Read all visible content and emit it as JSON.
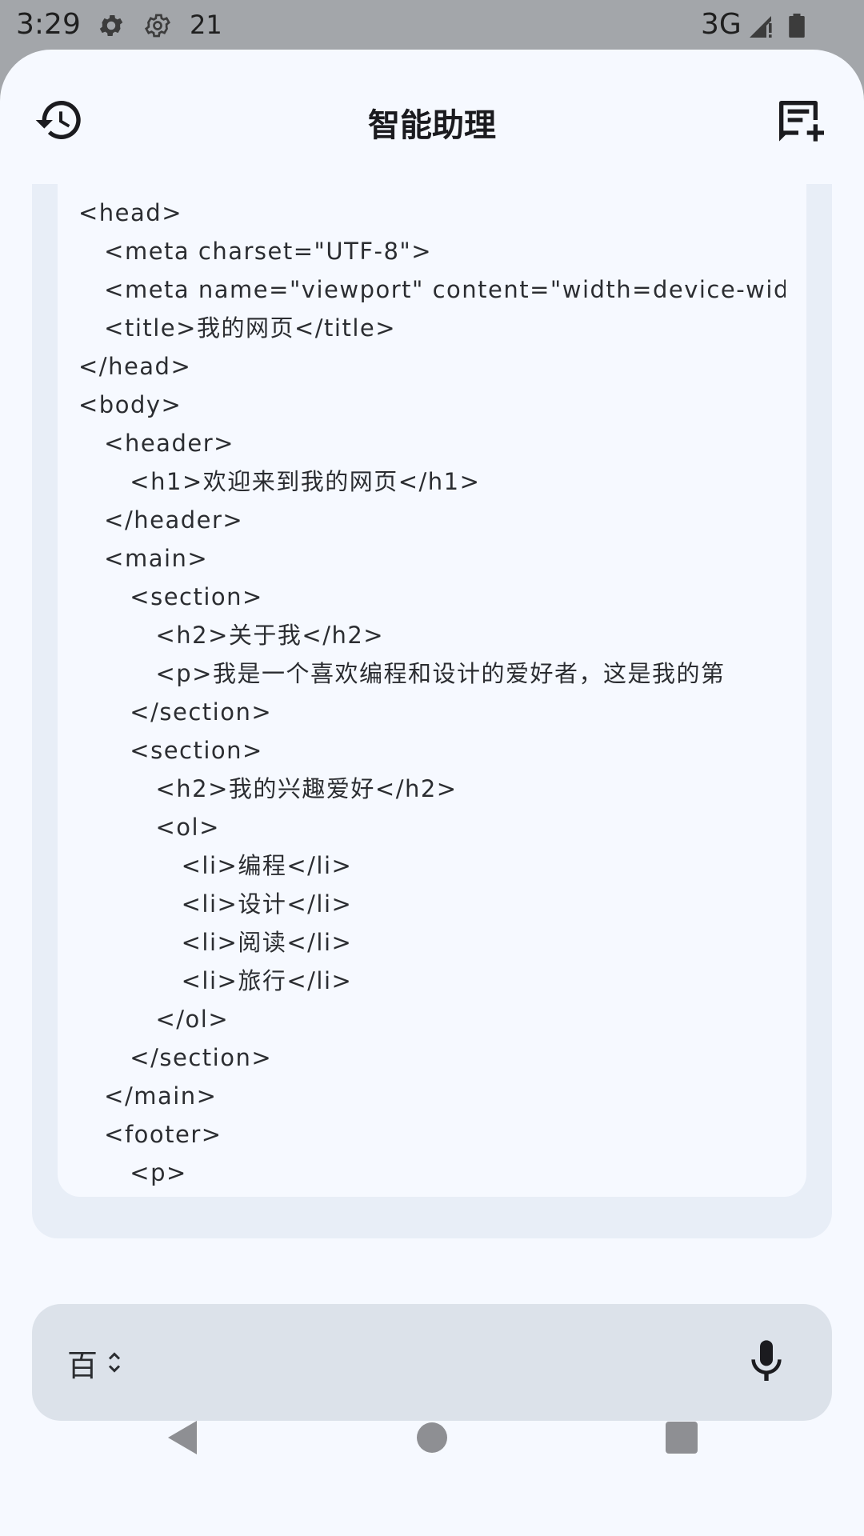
{
  "status_bar": {
    "time": "3:29",
    "notification_count": "21",
    "network": "3G",
    "icons": [
      "settings-gear-filled-icon",
      "settings-gear-outline-icon",
      "signal-icon",
      "battery-icon"
    ]
  },
  "header": {
    "title": "智能助理",
    "left_icon": "history-icon",
    "right_icon": "new-chat-icon"
  },
  "code_lines": [
    "<head>",
    "   <meta charset=\"UTF-8\">",
    "   <meta name=\"viewport\" content=\"width=device-width\">",
    "   <title>我的网页</title>",
    "</head>",
    "<body>",
    "   <header>",
    "      <h1>欢迎来到我的网页</h1>",
    "   </header>",
    "   <main>",
    "      <section>",
    "         <h2>关于我</h2>",
    "         <p>我是一个喜欢编程和设计的爱好者，这是我的第",
    "      </section>",
    "      <section>",
    "         <h2>我的兴趣爱好</h2>",
    "         <ol>",
    "            <li>编程</li>",
    "            <li>设计</li>",
    "            <li>阅读</li>",
    "            <li>旅行</li>",
    "         </ol>",
    "      </section>",
    "   </main>",
    "   <footer>",
    "      <p>"
  ],
  "input_bar": {
    "model_label": "百",
    "model_picker_icon": "unfold-icon",
    "mic_icon": "microphone-icon"
  },
  "nav_bar": {
    "icons": [
      "back-icon",
      "home-icon",
      "recents-icon"
    ]
  },
  "colors": {
    "sheet_bg": "#f6f9ff",
    "bubble_bg": "#e8eef7",
    "input_bg": "#dce2ea",
    "status_bg": "#a3a6aa",
    "text": "#1b1b1f"
  }
}
